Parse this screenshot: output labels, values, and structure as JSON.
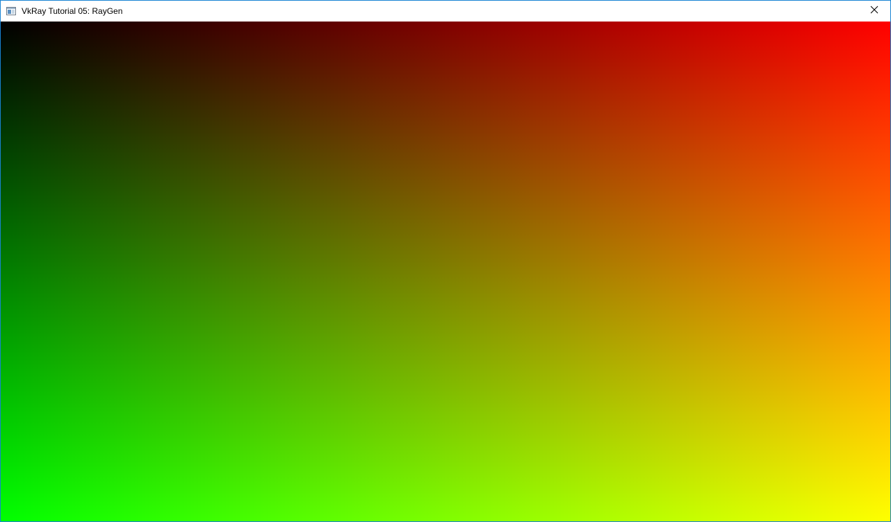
{
  "window": {
    "title": "VkRay Tutorial 05: RayGen",
    "app_icon": "window-icon",
    "close_icon": "close-icon",
    "border_color": "#1783d3"
  },
  "viewport": {
    "content": "raygen-gradient",
    "colors": {
      "top_left": "#000000",
      "top_right": "#ff0000",
      "bottom_left": "#00ff00",
      "bottom_right": "#ffff00"
    }
  }
}
